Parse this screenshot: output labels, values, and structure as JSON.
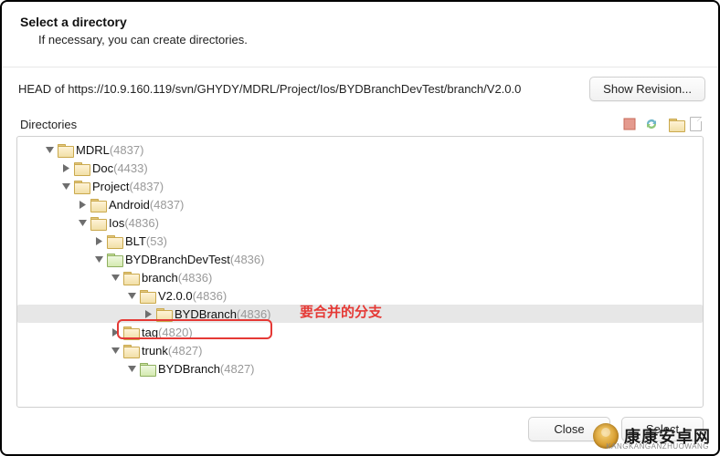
{
  "header": {
    "title": "Select a directory",
    "subtitle": "If necessary, you can create directories."
  },
  "url_bar": {
    "prefix": "HEAD of ",
    "url": "https://10.9.160.119/svn/GHYDY/MDRL/Project/Ios/BYDBranchDevTest/branch/V2.0.0",
    "show_revision": "Show Revision..."
  },
  "toolbar": {
    "label": "Directories"
  },
  "tree": [
    {
      "id": "mdrl",
      "indent": 1,
      "disclosure": "down",
      "folder": "yellow",
      "label": "MDRL",
      "rev": "(4837)"
    },
    {
      "id": "doc",
      "indent": 2,
      "disclosure": "right",
      "folder": "yellow",
      "label": "Doc",
      "rev": "(4433)"
    },
    {
      "id": "proj",
      "indent": 2,
      "disclosure": "down",
      "folder": "yellow",
      "label": "Project",
      "rev": "(4837)"
    },
    {
      "id": "andr",
      "indent": 3,
      "disclosure": "right",
      "folder": "yellow",
      "label": "Android",
      "rev": "(4837)"
    },
    {
      "id": "ios",
      "indent": 3,
      "disclosure": "down",
      "folder": "yellow",
      "label": "Ios",
      "rev": "(4836)"
    },
    {
      "id": "blt",
      "indent": 4,
      "disclosure": "right",
      "folder": "yellow",
      "label": "BLT",
      "rev": "(53)"
    },
    {
      "id": "bydd",
      "indent": 4,
      "disclosure": "down",
      "folder": "green",
      "label": "BYDBranchDevTest",
      "rev": "(4836)"
    },
    {
      "id": "br",
      "indent": 5,
      "disclosure": "down",
      "folder": "yellow",
      "label": "branch",
      "rev": "(4836)"
    },
    {
      "id": "v200",
      "indent": 6,
      "disclosure": "down",
      "folder": "yellow",
      "label": "V2.0.0",
      "rev": "(4836)"
    },
    {
      "id": "bydb",
      "indent": 7,
      "disclosure": "right",
      "folder": "yellow",
      "label": "BYDBranch",
      "rev": "(4836)",
      "selected": true
    },
    {
      "id": "tag",
      "indent": 5,
      "disclosure": "right",
      "folder": "yellow",
      "label": "tag",
      "rev": "(4820)"
    },
    {
      "id": "trunk",
      "indent": 5,
      "disclosure": "down",
      "folder": "yellow",
      "label": "trunk",
      "rev": "(4827)"
    },
    {
      "id": "bydb2",
      "indent": 6,
      "disclosure": "down",
      "folder": "green",
      "label": "BYDBranch",
      "rev": "(4827)"
    }
  ],
  "annotation": {
    "text": "要合并的分支"
  },
  "footer": {
    "close": "Close",
    "select": "Select"
  },
  "watermark": {
    "cn": "康康安卓网",
    "en": "KANGKANGANZHUOWANG"
  }
}
